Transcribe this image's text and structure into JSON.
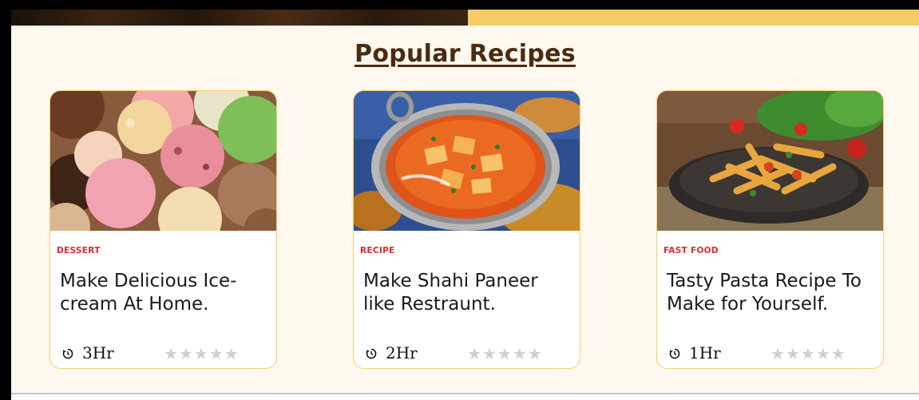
{
  "section": {
    "title": "Popular Recipes"
  },
  "colors": {
    "accent_yellow": "#f6cb66",
    "category_red": "#e2292b",
    "title_brown": "#4b2b10",
    "section_bg": "#fef8ee"
  },
  "cards": [
    {
      "image": "ice-cream-image",
      "category": "DESSERT",
      "title": "Make Delicious Ice-cream At Home.",
      "time": "3Hr",
      "rating": 0,
      "max_rating": 5
    },
    {
      "image": "shahi-paneer-image",
      "category": "RECIPE",
      "title": "Make Shahi Paneer like Restraunt.",
      "time": "2Hr",
      "rating": 0,
      "max_rating": 5
    },
    {
      "image": "pasta-image",
      "category": "FAST FOOD",
      "title": "Tasty Pasta Recipe To Make for Yourself.",
      "time": "1Hr",
      "rating": 0,
      "max_rating": 5
    }
  ],
  "icons": {
    "time": "clock-icon",
    "star": "star-icon"
  }
}
